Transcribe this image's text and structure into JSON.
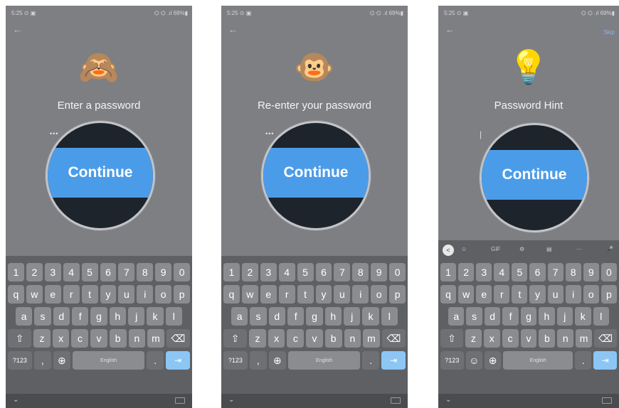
{
  "screens": [
    {
      "status_time": "5:25 ⊙ ▣",
      "status_right": "⌬ ⌬ .ıl 69%▮",
      "emoji": "🙈",
      "title": "Enter a password",
      "field_display": "•••",
      "button_label": "Continue",
      "keyboard": {
        "toolbar": false,
        "row1": [
          "1",
          "2",
          "3",
          "4",
          "5",
          "6",
          "7",
          "8",
          "9",
          "0"
        ],
        "row2": [
          "q",
          "w",
          "e",
          "r",
          "t",
          "y",
          "u",
          "i",
          "o",
          "p"
        ],
        "row3": [
          "a",
          "s",
          "d",
          "f",
          "g",
          "h",
          "j",
          "k",
          "l"
        ],
        "row4": [
          "z",
          "x",
          "c",
          "v",
          "b",
          "n",
          "m"
        ],
        "sym_key": "?123",
        "comma_key": ",",
        "space_label": "English",
        "period_key": ".",
        "enter_glyph": "⇥"
      }
    },
    {
      "status_time": "5:25 ⊙ ▣",
      "status_right": "⌬ ⌬ .ıl 69%▮",
      "emoji": "🐵",
      "title": "Re-enter your password",
      "field_display": "•••",
      "button_label": "Continue",
      "keyboard": {
        "toolbar": false,
        "row1": [
          "1",
          "2",
          "3",
          "4",
          "5",
          "6",
          "7",
          "8",
          "9",
          "0"
        ],
        "row2": [
          "q",
          "w",
          "e",
          "r",
          "t",
          "y",
          "u",
          "i",
          "o",
          "p"
        ],
        "row3": [
          "a",
          "s",
          "d",
          "f",
          "g",
          "h",
          "j",
          "k",
          "l"
        ],
        "row4": [
          "z",
          "x",
          "c",
          "v",
          "b",
          "n",
          "m"
        ],
        "sym_key": "?123",
        "comma_key": ",",
        "space_label": "English",
        "period_key": ".",
        "enter_glyph": "⇥"
      }
    },
    {
      "status_time": "5:25 ⊙ ▣",
      "status_right": "⌬ ⌬ .ıl 69%▮",
      "skip_label": "Skip",
      "emoji": "💡",
      "title": "Password Hint",
      "field_display": "|",
      "button_label": "Continue",
      "keyboard": {
        "toolbar": true,
        "toolbar_items": [
          "<",
          "☺",
          "GIF",
          "⚙",
          "▤",
          "···",
          "🎤"
        ],
        "row1": [
          "1",
          "2",
          "3",
          "4",
          "5",
          "6",
          "7",
          "8",
          "9",
          "0"
        ],
        "row2": [
          "q",
          "w",
          "e",
          "r",
          "t",
          "y",
          "u",
          "i",
          "o",
          "p"
        ],
        "row3": [
          "a",
          "s",
          "d",
          "f",
          "g",
          "h",
          "j",
          "k",
          "l"
        ],
        "row4": [
          "z",
          "x",
          "c",
          "v",
          "b",
          "n",
          "m"
        ],
        "sym_key": "?123",
        "comma_key": "☺",
        "space_label": "English",
        "period_key": ".",
        "enter_glyph": "⇥"
      }
    }
  ]
}
